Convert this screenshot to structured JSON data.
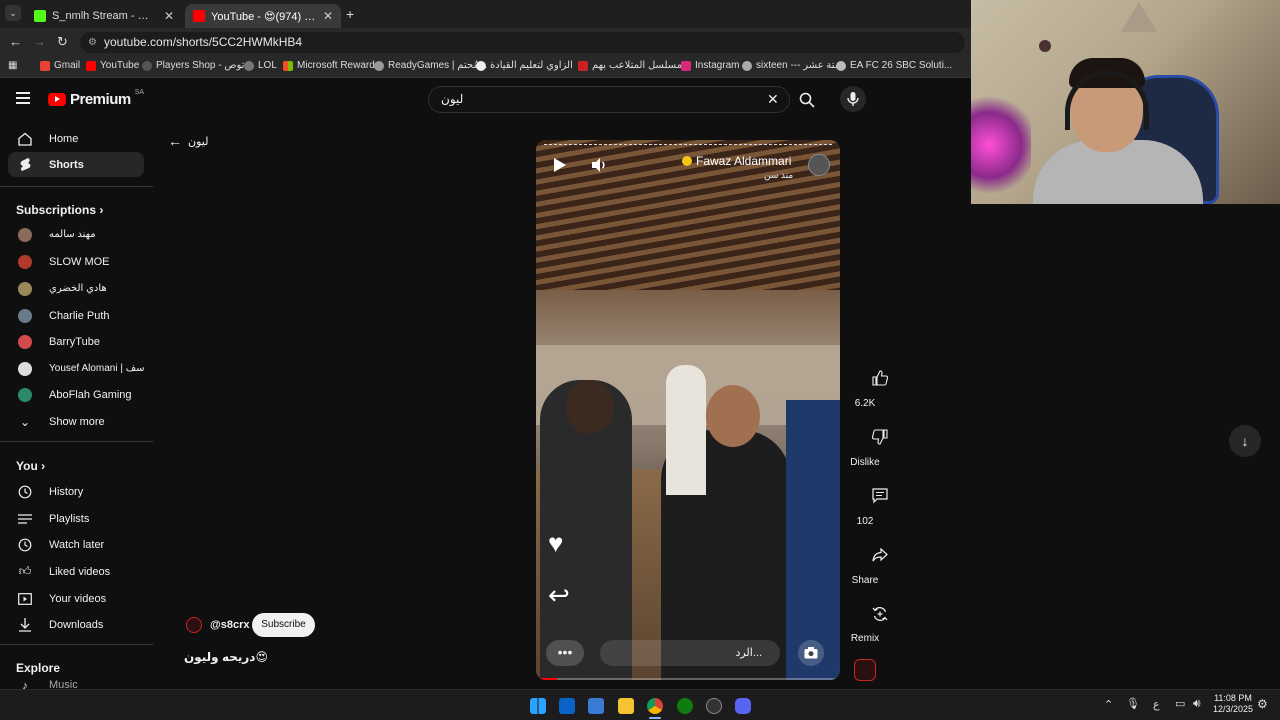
{
  "browser": {
    "tabs": [
      {
        "label": "S_nmlh Stream - Watch Live on",
        "active": false
      },
      {
        "label": "YouTube - 😍دريحه وليون (974)",
        "active": true
      }
    ],
    "url": "youtube.com/shorts/5CC2HWMkHB4",
    "bookmarks": [
      "Gmail",
      "YouTube",
      "Players Shop - توص...",
      "LOL",
      "Microsoft Rewards",
      "ReadyGames | مُحتم...",
      "الزاوي لتعليم القيادة",
      "مسلسل المتلاعب بهم...",
      "Instagram",
      "sixteen --- ستة عشر",
      "EA FC 26 SBC Soluti..."
    ]
  },
  "youtube": {
    "logo": "Premium",
    "region": "SA",
    "search_value": "ليون",
    "back_label": "ليون",
    "nav": {
      "home": "Home",
      "shorts": "Shorts"
    },
    "subscriptions_title": "Subscriptions",
    "subscriptions": [
      "مهند سالمه",
      "SLOW MOE",
      "هادي الخضري",
      "Charlie Puth",
      "BarryTube",
      "Yousef Alomani | يوسف...",
      "AboFlah Gaming"
    ],
    "show_more": "Show more",
    "you_title": "You",
    "you_items": [
      "History",
      "Playlists",
      "Watch later",
      "Liked videos",
      "Your videos",
      "Downloads"
    ],
    "explore_title": "Explore",
    "explore_partial": "Music"
  },
  "short": {
    "channel_overlay": "Fawaz Aldammari",
    "overlay_sub": "منذ سن",
    "comment_placeholder": "الرد...",
    "handle": "@s8crx",
    "subscribe": "Subscribe",
    "title": "دريحه وليون😍",
    "likes": "6.2K",
    "dislike": "Dislike",
    "comments": "102",
    "share": "Share",
    "remix": "Remix"
  },
  "taskbar": {
    "lang": "ع",
    "time": "11:08 PM",
    "date": "12/3/2025"
  }
}
